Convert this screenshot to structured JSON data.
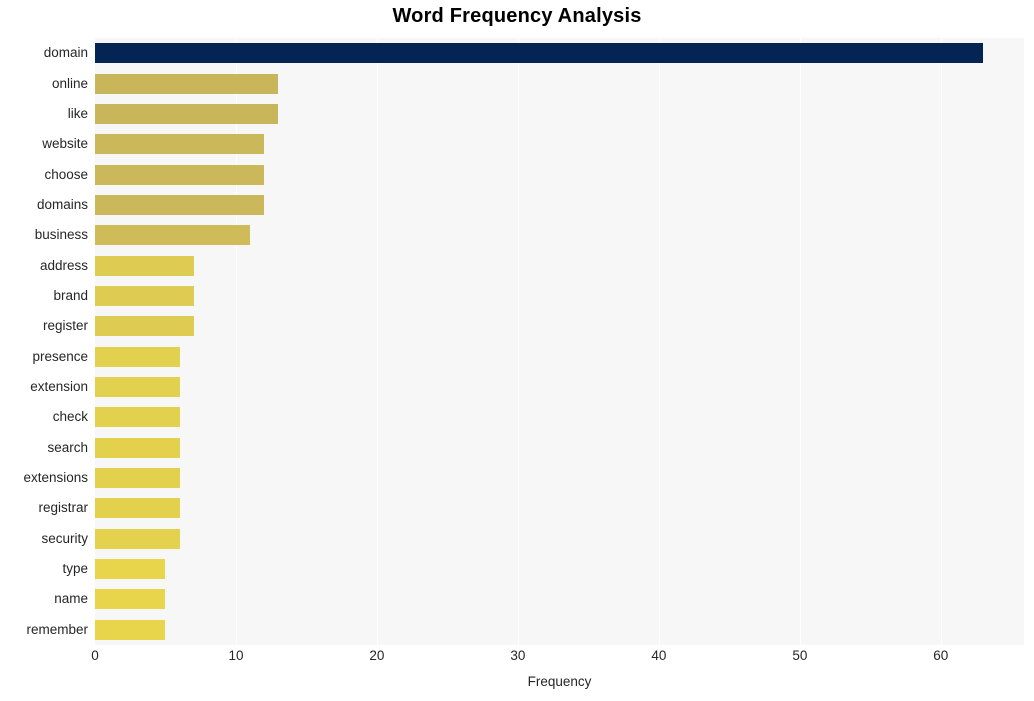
{
  "chart_data": {
    "type": "bar",
    "orientation": "horizontal",
    "title": "Word Frequency Analysis",
    "xlabel": "Frequency",
    "ylabel": "",
    "xlim": [
      0,
      65.9
    ],
    "xticks": [
      0,
      10,
      20,
      30,
      40,
      50,
      60
    ],
    "xticklabels": [
      "0",
      "10",
      "20",
      "30",
      "40",
      "50",
      "60"
    ],
    "grid": "vertical-white-on-light-gray",
    "legend": "none",
    "categories": [
      "domain",
      "online",
      "like",
      "website",
      "choose",
      "domains",
      "business",
      "address",
      "brand",
      "register",
      "presence",
      "extension",
      "check",
      "search",
      "extensions",
      "registrar",
      "security",
      "type",
      "name",
      "remember"
    ],
    "values": [
      63,
      13,
      13,
      12,
      12,
      12,
      11,
      7,
      7,
      7,
      6,
      6,
      6,
      6,
      6,
      6,
      6,
      5,
      5,
      5
    ],
    "bar_colors": [
      "#042454",
      "#c9b65b",
      "#c9b65b",
      "#cbb85a",
      "#cbb85a",
      "#cbb85a",
      "#cfbc58",
      "#ddcb52",
      "#ddcb52",
      "#ddcb52",
      "#e2d04f",
      "#e2d04f",
      "#e3d14e",
      "#e3d14e",
      "#e3d14e",
      "#e3d14e",
      "#e4d24e",
      "#e8d54c",
      "#e8d54c",
      "#e8d54c"
    ],
    "plot_background": "#f7f7f7",
    "highlight_color": "#042454",
    "figure_background": "#ffffff"
  },
  "axes": {
    "x_axis_title": "Frequency"
  }
}
